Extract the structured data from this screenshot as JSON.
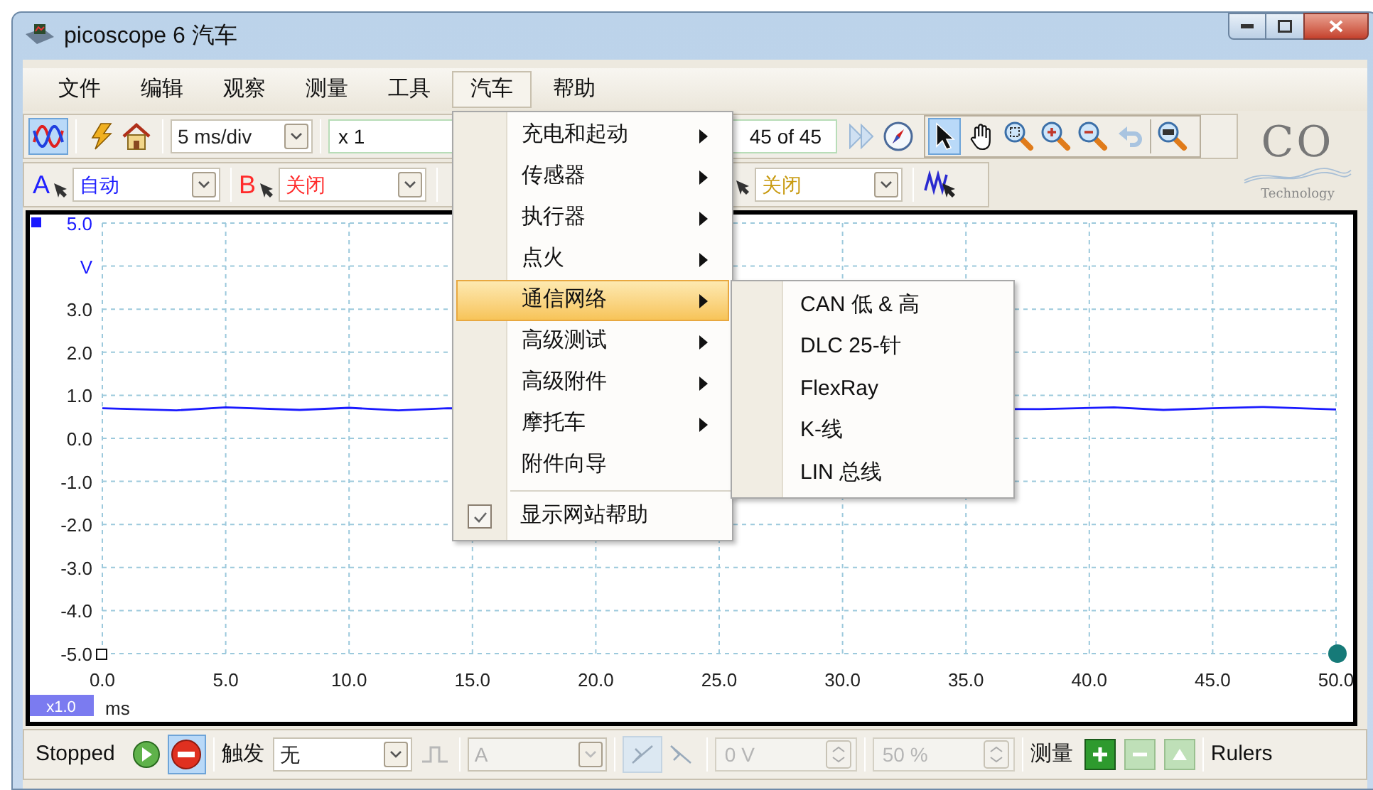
{
  "window": {
    "title": "picoscope 6 汽车"
  },
  "menu_bar": [
    {
      "label": "文件",
      "selected": false
    },
    {
      "label": "编辑",
      "selected": false
    },
    {
      "label": "观察",
      "selected": false
    },
    {
      "label": "测量",
      "selected": false
    },
    {
      "label": "工具",
      "selected": false
    },
    {
      "label": "汽车",
      "selected": true
    },
    {
      "label": "帮助",
      "selected": false
    }
  ],
  "toolbar": {
    "scope_mode_selected": true,
    "timebase": "5 ms/div",
    "zoom": "x 1",
    "capture_counter": "45 of 45",
    "tools": [
      {
        "kind": "pointer",
        "selected": true
      },
      {
        "kind": "hand",
        "selected": false
      },
      {
        "kind": "zoom-region",
        "selected": false
      },
      {
        "kind": "zoom-in",
        "selected": false
      },
      {
        "kind": "zoom-out",
        "selected": false
      },
      {
        "kind": "undo-zoom",
        "selected": false
      },
      {
        "kind": "zoom-full",
        "selected": false
      }
    ]
  },
  "logo": {
    "text": "CO",
    "tagline": "Technology"
  },
  "channel_bar": [
    {
      "label": "A",
      "range": "自动",
      "color": "#2020ff"
    },
    {
      "label": "B",
      "range": "关闭",
      "color": "#ff2a2a"
    },
    {
      "range": "关闭",
      "color": "#c89a10"
    }
  ],
  "dropdown_menu": {
    "items": [
      {
        "kind": "submenu",
        "label": "充电和起动",
        "selected": false
      },
      {
        "kind": "submenu",
        "label": "传感器",
        "selected": false
      },
      {
        "kind": "submenu",
        "label": "执行器",
        "selected": false
      },
      {
        "kind": "submenu",
        "label": "点火",
        "selected": false
      },
      {
        "kind": "submenu",
        "label": "通信网络",
        "selected": true
      },
      {
        "kind": "submenu",
        "label": "高级测试",
        "selected": false
      },
      {
        "kind": "submenu",
        "label": "高级附件",
        "selected": false
      },
      {
        "kind": "submenu",
        "label": "摩托车",
        "selected": false
      },
      {
        "kind": "item",
        "label": "附件向导",
        "selected": false
      },
      {
        "kind": "separator"
      },
      {
        "kind": "checkbox",
        "label": "显示网站帮助",
        "checked": true,
        "selected": false
      }
    ],
    "submenu": [
      "CAN 低 & 高",
      "DLC 25-针",
      "FlexRay",
      "K-线",
      "LIN 总线"
    ]
  },
  "scope": {
    "zoom_badge": "x1.0",
    "chart_data": {
      "type": "line",
      "xlabel": "ms",
      "ylabel": "V",
      "xlim": [
        0,
        50
      ],
      "ylim": [
        -5,
        5
      ],
      "xticks": [
        {
          "value": 0,
          "label": "0.0"
        },
        {
          "value": 5,
          "label": "5.0"
        },
        {
          "value": 10,
          "label": "10.0"
        },
        {
          "value": 15,
          "label": "15.0"
        },
        {
          "value": 20,
          "label": "20.0"
        },
        {
          "value": 25,
          "label": "25.0"
        },
        {
          "value": 30,
          "label": "30.0"
        },
        {
          "value": 35,
          "label": "35.0"
        },
        {
          "value": 40,
          "label": "40.0"
        },
        {
          "value": 45,
          "label": "45.0"
        },
        {
          "value": 50,
          "label": "50.0"
        }
      ],
      "yticks": [
        {
          "value": 5,
          "label": "5.0"
        },
        {
          "value": 3,
          "label": "3.0"
        },
        {
          "value": 2,
          "label": "2.0"
        },
        {
          "value": 1,
          "label": "1.0"
        },
        {
          "value": 0,
          "label": "0.0"
        },
        {
          "value": -1,
          "label": "-1.0"
        },
        {
          "value": -2,
          "label": "-2.0"
        },
        {
          "value": -3,
          "label": "-3.0"
        },
        {
          "value": -4,
          "label": "-4.0"
        },
        {
          "value": -5,
          "label": "-5.0"
        }
      ],
      "grid": true,
      "x": [
        0,
        3,
        5,
        8,
        10,
        12,
        14,
        38,
        41,
        43,
        45,
        47,
        50
      ],
      "series": [
        {
          "color": "#1a1aff",
          "values": [
            0.7,
            0.65,
            0.72,
            0.66,
            0.71,
            0.65,
            0.7,
            0.68,
            0.72,
            0.66,
            0.7,
            0.73,
            0.67
          ]
        }
      ]
    }
  },
  "status_bar": {
    "state": "Stopped",
    "stop_selected": true,
    "trigger_label": "触发",
    "trigger_mode": "无",
    "trigger_source": "A",
    "threshold": "0 V",
    "pretrigger": "50 %",
    "measurements_label": "测量",
    "rulers_label": "Rulers"
  }
}
